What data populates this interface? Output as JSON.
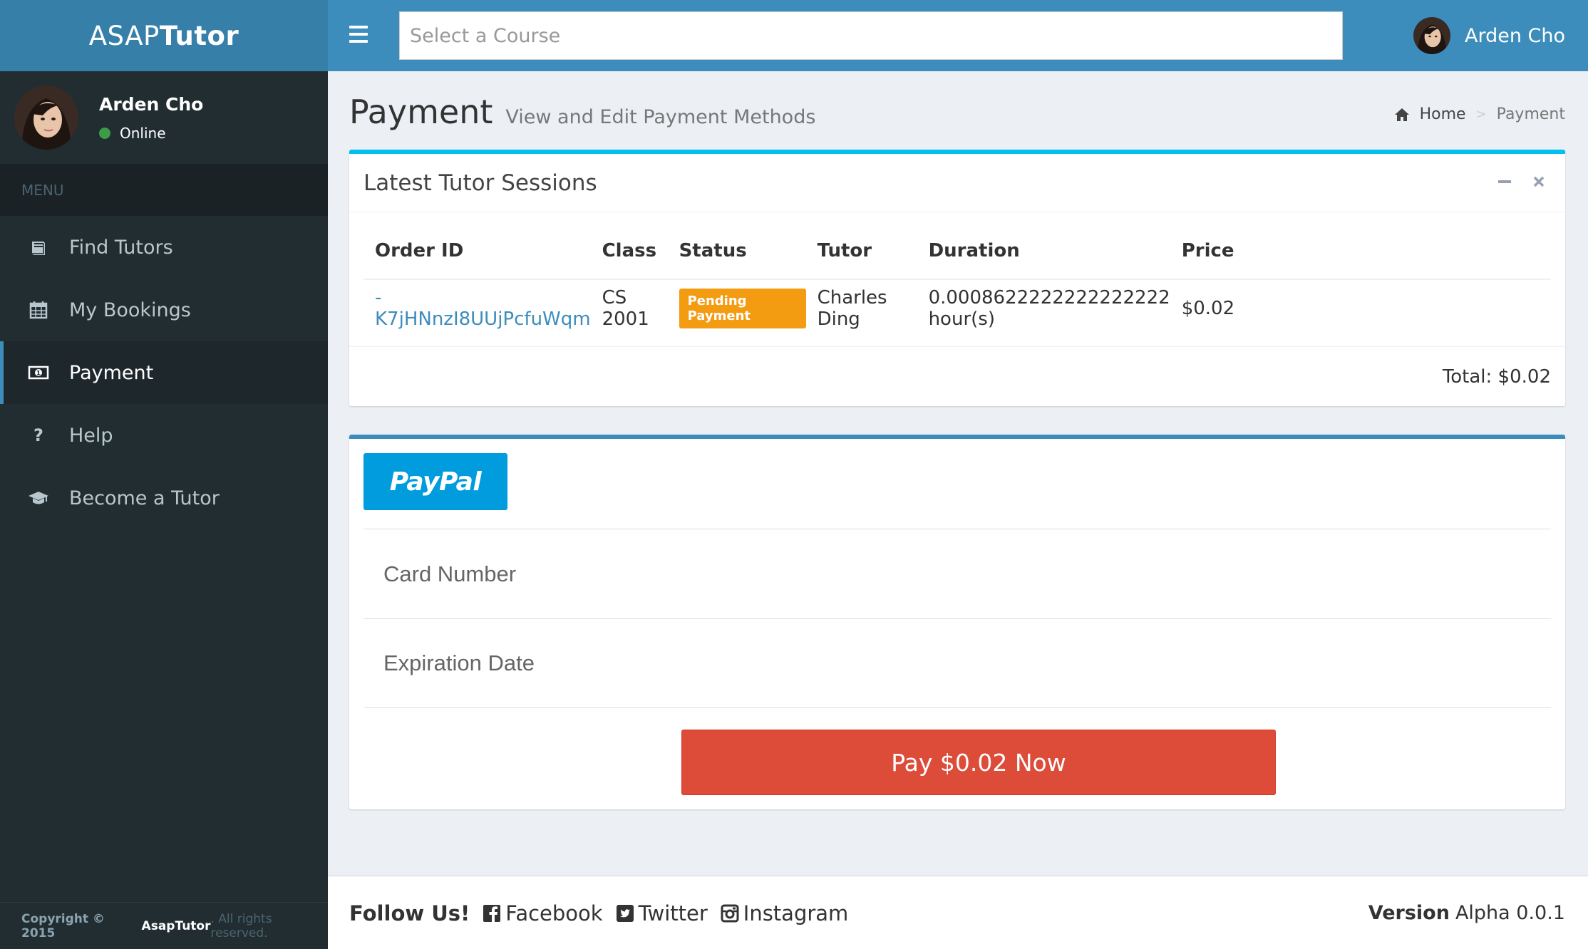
{
  "brand": {
    "light": "ASAP",
    "bold": "Tutor"
  },
  "user": {
    "name": "Arden Cho",
    "status": "Online"
  },
  "sidebar": {
    "header": "MENU",
    "items": [
      {
        "label": "Find Tutors",
        "icon": "book-icon"
      },
      {
        "label": "My Bookings",
        "icon": "calendar-icon"
      },
      {
        "label": "Payment",
        "icon": "money-icon",
        "active": true
      },
      {
        "label": "Help",
        "icon": "question-icon"
      },
      {
        "label": "Become a Tutor",
        "icon": "graduation-cap-icon"
      }
    ],
    "footer": {
      "prefix": "Copyright © 2015",
      "company": "AsapTutor",
      "suffix": ". All rights reserved."
    }
  },
  "topbar": {
    "course_placeholder": "Select a Course"
  },
  "page": {
    "title": "Payment",
    "subtitle": "View and Edit Payment Methods"
  },
  "breadcrumb": {
    "home": "Home",
    "current": "Payment"
  },
  "sessions": {
    "title": "Latest Tutor Sessions",
    "columns": [
      "Order ID",
      "Class",
      "Status",
      "Tutor",
      "Duration",
      "Price"
    ],
    "rows": [
      {
        "order_id": "-K7jHNnzI8UUjPcfuWqm",
        "class": "CS 2001",
        "status": "Pending Payment",
        "tutor": "Charles Ding",
        "duration": "0.0008622222222222222 hour(s)",
        "price": "$0.02"
      }
    ],
    "total": "Total: $0.02"
  },
  "payment": {
    "paypal_label": "PayPal",
    "card_number_placeholder": "Card Number",
    "expiration_placeholder": "Expiration Date",
    "pay_button": "Pay $0.02 Now"
  },
  "footer": {
    "follow": "Follow Us!",
    "links": [
      "Facebook",
      "Twitter",
      "Instagram"
    ],
    "version_label": "Version",
    "version_value": "Alpha 0.0.1"
  },
  "colors": {
    "primary": "#3c8dbc",
    "sidebar_bg": "#222d32",
    "info_accent": "#00c0ef",
    "pending_badge": "#f39c12",
    "pay_button": "#dd4b39",
    "paypal": "#009cde"
  }
}
